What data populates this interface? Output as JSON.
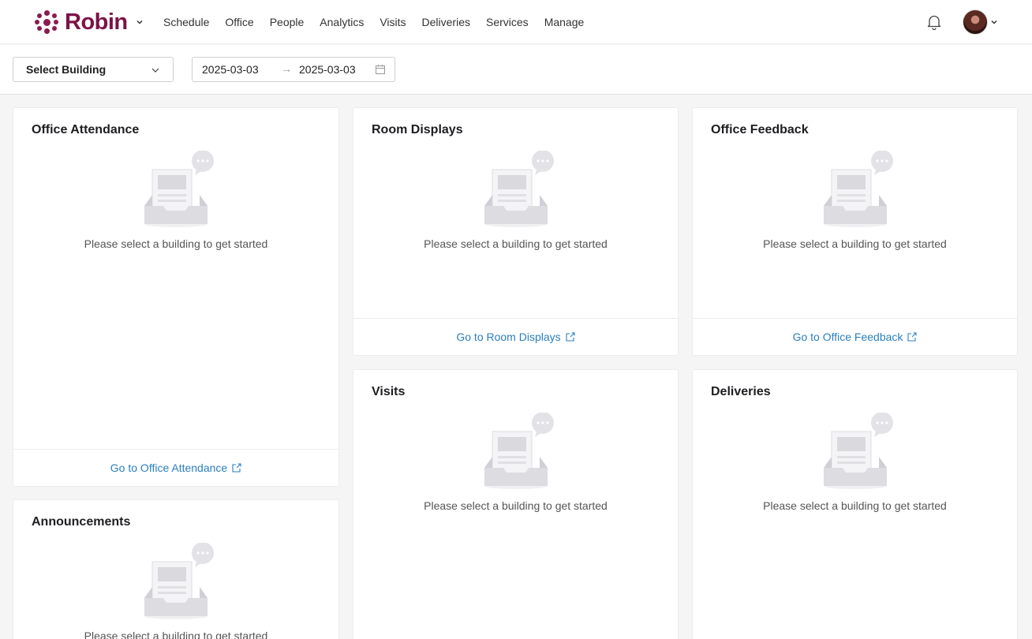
{
  "app": {
    "brand": "Robin"
  },
  "nav": {
    "items": [
      "Schedule",
      "Office",
      "People",
      "Analytics",
      "Visits",
      "Deliveries",
      "Services",
      "Manage"
    ]
  },
  "filters": {
    "building_select": "Select Building",
    "date_start": "2025-03-03",
    "date_arrow": "→",
    "date_end": "2025-03-03"
  },
  "colors": {
    "brand": "#7b1247",
    "link": "#2a7fc0"
  },
  "empty_message": "Please select a building to get started",
  "cards": {
    "office_attendance": {
      "title": "Office Attendance",
      "footer": "Go to Office Attendance"
    },
    "room_displays": {
      "title": "Room Displays",
      "footer": "Go to Room Displays"
    },
    "office_feedback": {
      "title": "Office Feedback",
      "footer": "Go to Office Feedback"
    },
    "visits": {
      "title": "Visits"
    },
    "deliveries": {
      "title": "Deliveries"
    },
    "announcements": {
      "title": "Announcements"
    }
  }
}
